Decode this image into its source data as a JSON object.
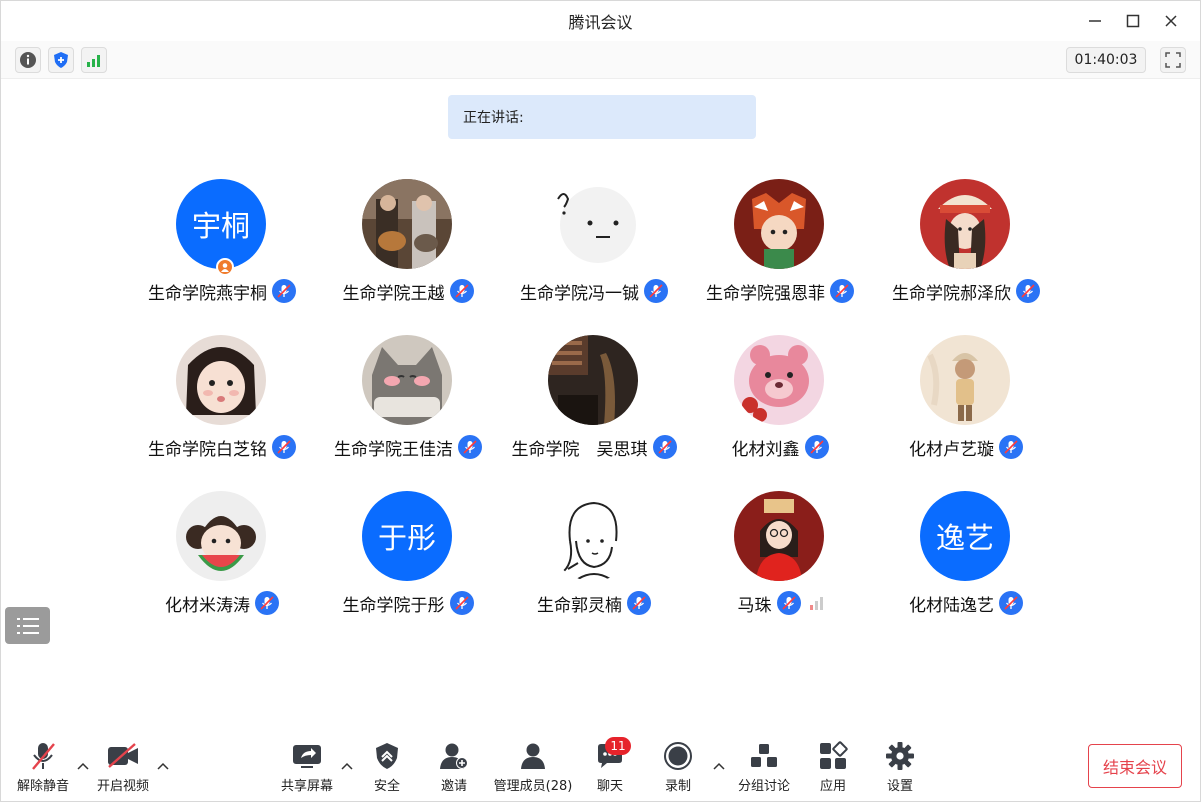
{
  "window": {
    "title": "腾讯会议"
  },
  "infobar": {
    "timer": "01:40:03"
  },
  "speaking": {
    "label": "正在讲话:"
  },
  "colors": {
    "accent": "#0a6cff",
    "end": "#e5434c",
    "badge": "#e6232b",
    "speaking_bg": "#dce9fb"
  },
  "participants": [
    {
      "name": "生命学院燕宇桐",
      "avatar_text": "宇桐",
      "host": true
    },
    {
      "name": "生命学院王越",
      "avatar_icon": "guitar-duo-photo"
    },
    {
      "name": "生命学院冯一铖",
      "avatar_icon": "round-face-doodle"
    },
    {
      "name": "生命学院强恩菲",
      "avatar_icon": "red-panda-girl-illustration"
    },
    {
      "name": "生命学院郝泽欣",
      "avatar_icon": "girl-hat-photo"
    },
    {
      "name": "生命学院白芝铭",
      "avatar_icon": "little-girl-photo"
    },
    {
      "name": "生命学院王佳洁",
      "avatar_icon": "gray-cat-photo"
    },
    {
      "name": "生命学院　吴思琪",
      "avatar_icon": "dark-room-photo"
    },
    {
      "name": "化材刘鑫",
      "avatar_icon": "pink-bear-illustration"
    },
    {
      "name": "化材卢艺璇",
      "avatar_icon": "beige-figure-illustration"
    },
    {
      "name": "化材米涛涛",
      "avatar_icon": "watermelon-girl-illustration"
    },
    {
      "name": "生命学院于彤",
      "avatar_text": "于彤"
    },
    {
      "name": "生命郭灵楠",
      "avatar_icon": "line-girl-sketch"
    },
    {
      "name": "马珠",
      "avatar_icon": "red-sweater-girl-illustration",
      "signal": true
    },
    {
      "name": "化材陆逸艺",
      "avatar_text": "逸艺"
    }
  ],
  "toolbar": {
    "unmute": "解除静音",
    "start_video": "开启视频",
    "share": "共享屏幕",
    "security": "安全",
    "invite": "邀请",
    "members": "管理成员(28)",
    "chat": "聊天",
    "chat_badge": "11",
    "record": "录制",
    "breakout": "分组讨论",
    "apps": "应用",
    "settings": "设置",
    "end": "结束会议"
  }
}
